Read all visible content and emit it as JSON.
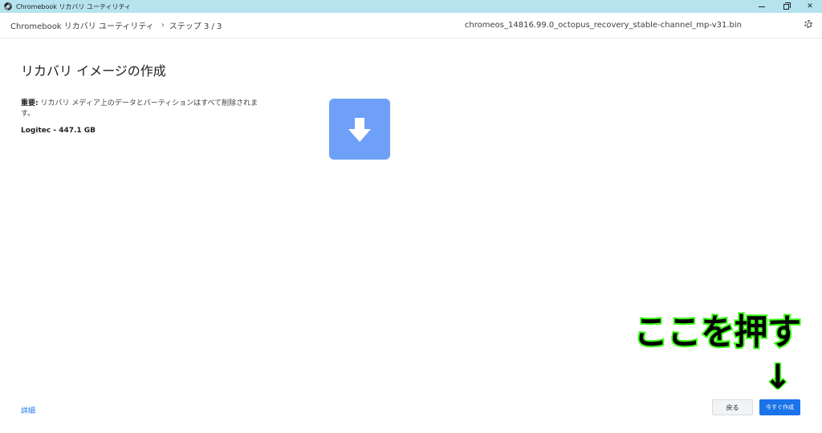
{
  "titlebar": {
    "title": "Chromebook リカバリ ユーティリティ",
    "minimize": "minimize",
    "maximize": "maximize",
    "close": "✕"
  },
  "header": {
    "app": "Chromebook リカバリ ユーティリティ",
    "separator": "›",
    "step": "ステップ 3 / 3",
    "filename": "chromeos_14816.99.0_octopus_recovery_stable-channel_mp-v31.bin"
  },
  "main": {
    "title": "リカバリ イメージの作成",
    "warning_label": "重要:",
    "warning_text": " リカバリ メディア上のデータとパーティションはすべて削除されます。",
    "device": "Logitec - 447.1 GB"
  },
  "footer": {
    "details": "詳細",
    "back": "戻る",
    "create_now": "今すぐ作成"
  },
  "annotation": {
    "text": "ここを押す",
    "arrow": "↓"
  },
  "colors": {
    "titlebar": "#b6e3ee",
    "tile": "#6ea0f8",
    "primary": "#1a73e8",
    "annotation_fill": "#000000",
    "annotation_outline": "#39ff14"
  },
  "icons": {
    "app": "recovery-app-icon",
    "settings": "gear-icon",
    "download": "download-arrow-icon"
  }
}
